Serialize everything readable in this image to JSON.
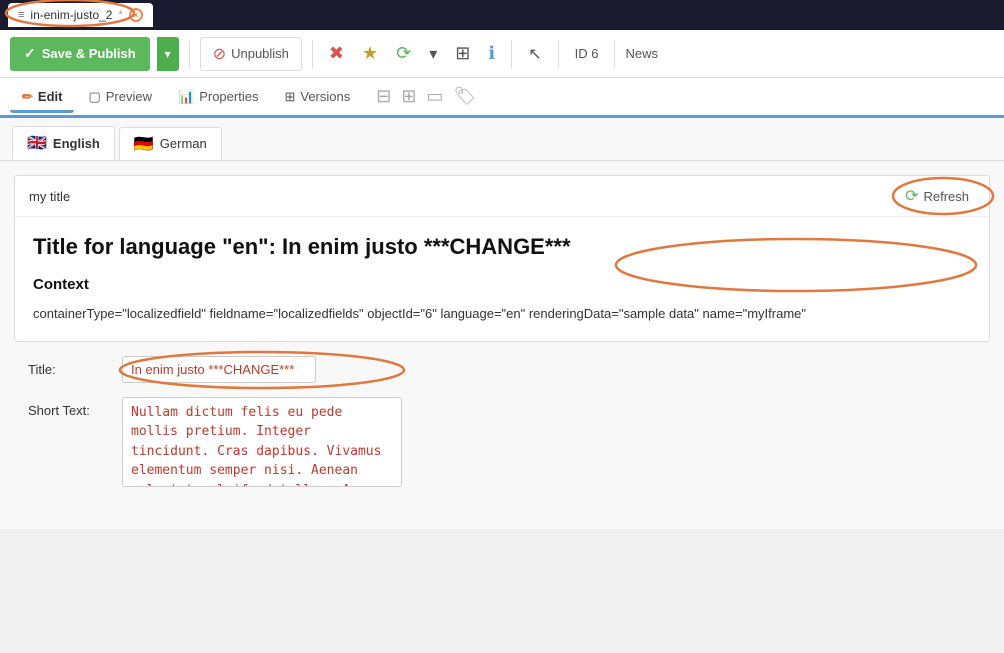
{
  "tab": {
    "icon": "≡",
    "label": "in-enim-justo_2",
    "unsaved_marker": "*",
    "close_label": "×"
  },
  "toolbar": {
    "save_publish_label": "Save & Publish",
    "unpublish_label": "Unpublish",
    "id_label": "ID 6",
    "news_label": "News",
    "dropdown_arrow": "▾"
  },
  "edit_tabs": [
    {
      "id": "edit",
      "label": "Edit",
      "icon": "✏"
    },
    {
      "id": "preview",
      "label": "Preview",
      "icon": "⬜"
    },
    {
      "id": "properties",
      "label": "Properties",
      "icon": "📊"
    },
    {
      "id": "versions",
      "label": "Versions",
      "icon": "⬛"
    }
  ],
  "languages": [
    {
      "id": "en",
      "flag": "🇬🇧",
      "label": "English",
      "active": true
    },
    {
      "id": "de",
      "flag": "🇩🇪",
      "label": "German",
      "active": false
    }
  ],
  "panel": {
    "title": "my title",
    "refresh_label": "Refresh",
    "main_title_prefix": "Title for language \"en\": In enim justo ",
    "main_title_change": "***CHANGE***",
    "context_heading": "Context",
    "context_text": "containerType=\"localizedfield\" fieldname=\"localizedfields\" objectId=\"6\" language=\"en\" renderingData=\"sample data\"\nname=\"myIframe\""
  },
  "form": {
    "title_label": "Title:",
    "title_value": "In enim justo ***CHANGE***",
    "shorttext_label": "Short Text:",
    "shorttext_value": "Nullam dictum felis eu pede mollis pretium. Integer tincidunt. Cras dapibus. Vivamus elementum semper nisi. Aenean vulputate eleifend tellus. Aenean leo ligula, porttitor eu, consequat vitae, eleifend ac, enim."
  },
  "icons": {
    "refresh": "↻",
    "check": "✓",
    "no": "⊘",
    "star": "★",
    "sync": "⟳",
    "dropdown": "▾",
    "apps": "⊞",
    "info": "ℹ",
    "cursor": "↖",
    "edit_pencil": "✏",
    "preview_square": "▢",
    "properties_chart": "⠿",
    "versions_grid": "⊞"
  }
}
